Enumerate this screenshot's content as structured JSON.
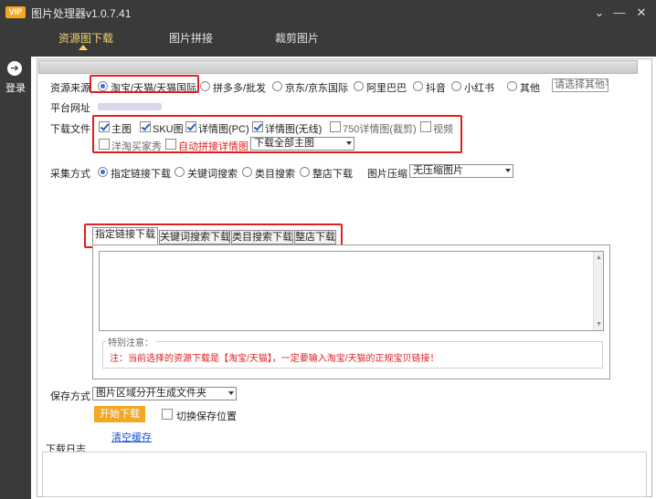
{
  "app": {
    "logo_text": "VIP",
    "title": "图片处理器v1.0.7.41",
    "controls": {
      "menu": "⌄",
      "minimize": "—",
      "maximize": "☐",
      "close": "✕"
    }
  },
  "tabs": [
    {
      "label": "资源图下载",
      "active": true
    },
    {
      "label": "图片拼接",
      "active": false
    },
    {
      "label": "裁剪图片",
      "active": false
    }
  ],
  "sidebar": {
    "login_label": "登录",
    "login_icon": "arrow-right-circle-icon"
  },
  "source": {
    "label": "资源来源",
    "options": [
      {
        "label": "淘宝/天猫/天猫国际",
        "selected": true
      },
      {
        "label": "拼多多/批发",
        "selected": false
      },
      {
        "label": "京东/京东国际",
        "selected": false
      },
      {
        "label": "阿里巴巴",
        "selected": false
      },
      {
        "label": "抖音",
        "selected": false
      },
      {
        "label": "小红书",
        "selected": false
      },
      {
        "label": "其他",
        "selected": false
      }
    ],
    "other_placeholder": "请选择其他平"
  },
  "platform_url": {
    "label": "平台网址"
  },
  "download_files": {
    "label": "下载文件",
    "options": [
      {
        "label": "主图",
        "checked": true
      },
      {
        "label": "SKU图",
        "checked": true
      },
      {
        "label": "详情图(PC)",
        "checked": true
      },
      {
        "label": "详情图(无线)",
        "checked": true
      },
      {
        "label": "750详情图(裁剪)",
        "checked": false
      },
      {
        "label": "视频",
        "checked": false
      },
      {
        "label": "洋淘买家秀",
        "checked": false
      },
      {
        "label": "自动拼接详情图",
        "checked": false
      }
    ],
    "main_image_select": "下载全部主图"
  },
  "collect": {
    "label": "采集方式",
    "options": [
      {
        "label": "指定链接下载",
        "selected": true
      },
      {
        "label": "关键词搜索",
        "selected": false
      },
      {
        "label": "类目搜索",
        "selected": false
      },
      {
        "label": "整店下载",
        "selected": false
      }
    ],
    "compress_label": "图片压缩",
    "compress_select": "无压缩图片"
  },
  "subtabs": [
    {
      "label": "指定链接下载",
      "active": true
    },
    {
      "label": "关键词搜索下载",
      "active": false
    },
    {
      "label": "类目搜索下载",
      "active": false
    },
    {
      "label": "整店下载",
      "active": false
    }
  ],
  "notice": {
    "legend": "特别注意：",
    "text": "注：当前选择的资源下载是【淘宝/天猫】，一定要输入淘宝/天猫的正规宝贝链接！"
  },
  "save": {
    "label": "保存方式",
    "select": "图片区域分开生成文件夹",
    "start_button": "开始下载",
    "switch_label": "切换保存位置",
    "clear_cache": "清空缓存"
  },
  "log": {
    "label": "下载日志"
  },
  "colors": {
    "accent": "#f5a623",
    "highlight": "#e02020",
    "titlebar": "#3a3a3a",
    "link": "#1a4fd0"
  }
}
